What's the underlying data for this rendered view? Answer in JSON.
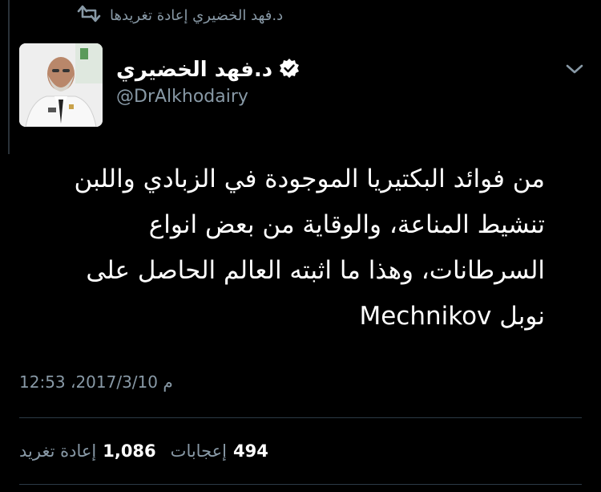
{
  "retweet_bar": {
    "text": "د.فهد الخضيري إعادة تغريدها",
    "icon": "retweet-icon"
  },
  "author": {
    "name": "د.فهد الخضيري",
    "handle": "@DrAlkhodairy",
    "verified": true,
    "verified_icon": "verified-badge-icon",
    "avatar_icon": "user-avatar"
  },
  "menu_icon": "chevron-down-icon",
  "tweet": {
    "line1": "من فوائد البكتيريا الموجودة في الزبادي واللبن",
    "line2": "تنشيط المناعة، والوقاية من بعض انواع",
    "line3": "السرطانات، وهذا ما اثبته العالم الحاصل على",
    "line4": "نوبل Mechnikov"
  },
  "timestamp": "12:53 ،2017/3/10 م",
  "stats": {
    "retweets_count": "1,086",
    "retweets_label": "إعادة تغريد",
    "likes_count": "494",
    "likes_label": "إعجابات"
  },
  "colors": {
    "background": "#000000",
    "primary_text": "#ffffff",
    "secondary_text": "#8899a6",
    "divider": "#2b3a46"
  }
}
